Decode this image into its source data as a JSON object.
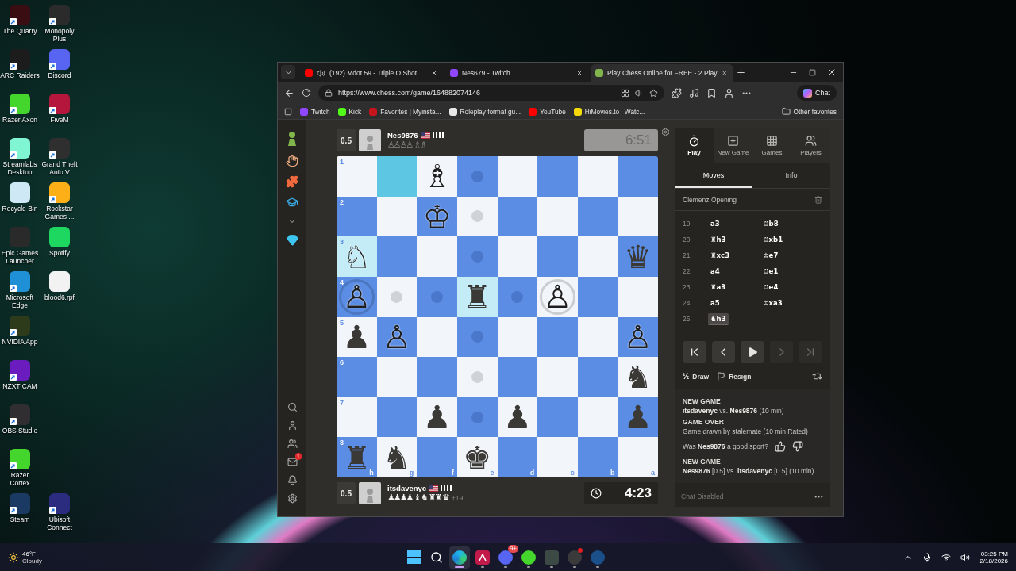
{
  "desktop": {
    "rows": [
      {
        "items": [
          {
            "label": "The Quarry",
            "color": "#3a0d12",
            "shortcut": true
          },
          {
            "label": "Monopoly Plus",
            "color": "#2b2b2b",
            "shortcut": true
          }
        ]
      },
      {
        "items": [
          {
            "label": "ARC Raiders",
            "color": "#1c1c1c",
            "shortcut": true
          },
          {
            "label": "Discord",
            "color": "#5865f2",
            "shortcut": true
          }
        ]
      },
      {
        "items": [
          {
            "label": "Razer Axon",
            "color": "#44d62c",
            "shortcut": true
          },
          {
            "label": "FiveM",
            "color": "#b5173c",
            "shortcut": true
          }
        ]
      },
      {
        "items": [
          {
            "label": "Streamlabs Desktop",
            "color": "#80f5d2",
            "shortcut": true
          },
          {
            "label": "Grand Theft Auto V",
            "color": "#2f2f2f",
            "shortcut": true
          }
        ]
      },
      {
        "items": [
          {
            "label": "Recycle Bin",
            "color": "#cfe8f5",
            "shortcut": false
          },
          {
            "label": "Rockstar Games ...",
            "color": "#fcaf17",
            "shortcut": true
          }
        ]
      },
      {
        "items": [
          {
            "label": "Epic Games Launcher",
            "color": "#2a2a2a",
            "shortcut": false
          },
          {
            "label": "Spotify",
            "color": "#1ed760",
            "shortcut": false
          }
        ]
      },
      {
        "items": [
          {
            "label": "Microsoft Edge",
            "color": "#1f8fd6",
            "shortcut": true
          },
          {
            "label": "blood6.rpf",
            "color": "#f2f2f2",
            "shortcut": false
          }
        ]
      },
      {
        "items": [
          {
            "label": "NVIDIA App",
            "color": "#2e3b1a",
            "shortcut": true
          }
        ]
      },
      {
        "items": [
          {
            "label": "NZXT CAM",
            "color": "#6a1cbf",
            "shortcut": true
          }
        ]
      },
      {
        "items": [
          {
            "label": "OBS Studio",
            "color": "#302e31",
            "shortcut": true
          }
        ]
      },
      {
        "items": [
          {
            "label": "Razer Cortex",
            "color": "#44d62c",
            "shortcut": true
          }
        ]
      },
      {
        "items": [
          {
            "label": "Steam",
            "color": "#1b3a63",
            "shortcut": true
          },
          {
            "label": "Ubisoft Connect",
            "color": "#2b2b80",
            "shortcut": true
          }
        ]
      }
    ]
  },
  "browser": {
    "tabs": [
      {
        "title": "(192) Mdot 59 - Triple O Shot",
        "color": "#ff0000",
        "audio": true,
        "selected": false
      },
      {
        "title": "Nes679 - Twitch",
        "color": "#9146ff",
        "audio": false,
        "selected": false
      },
      {
        "title": "Play Chess Online for FREE - 2 Play",
        "color": "#81b64c",
        "audio": false,
        "selected": true
      }
    ],
    "address": "https://www.chess.com/game/164882074146",
    "chat_button": "Chat",
    "bookmarks": [
      {
        "label": "Twitch",
        "color": "#9146ff"
      },
      {
        "label": "Kick",
        "color": "#53fc18"
      },
      {
        "label": "Favorites | Myinsta...",
        "color": "#c4161c"
      },
      {
        "label": "Roleplay format gu...",
        "color": "#e8e8e8"
      },
      {
        "label": "YouTube",
        "color": "#ff0000"
      },
      {
        "label": "HiMovies.to | Watc...",
        "color": "#f5d90a"
      }
    ],
    "other_favorites": "Other favorites"
  },
  "chess": {
    "messages_badge": "1",
    "top_player": {
      "score": "0.5",
      "name": "Nes9876",
      "captured": "♙♙♙♙ ♗♗",
      "clock": "6:51",
      "active": false
    },
    "board": {
      "files": [
        "h",
        "g",
        "f",
        "e",
        "d",
        "c",
        "b",
        "a"
      ],
      "ranks": [
        {
          "label": "1",
          "squares": [
            {
              "dot": false,
              "ring": false,
              "highlighted": false
            },
            {
              "dot": false,
              "ring": false,
              "highlighted": true
            },
            {
              "piece": "♗",
              "white": true,
              "dot": false,
              "ring": false,
              "highlighted": false
            },
            {
              "dot": true,
              "ring": false,
              "highlighted": false
            },
            {
              "dot": false,
              "ring": false,
              "highlighted": false
            },
            {
              "dot": false,
              "ring": false,
              "highlighted": false
            },
            {
              "dot": false,
              "ring": false,
              "highlighted": false
            },
            {
              "dot": false,
              "ring": false,
              "highlighted": false
            }
          ]
        },
        {
          "label": "2",
          "squares": [
            {
              "dot": false,
              "ring": false,
              "highlighted": false
            },
            {
              "dot": false,
              "ring": false,
              "highlighted": false
            },
            {
              "piece": "♔",
              "white": true,
              "dot": false,
              "ring": false,
              "highlighted": false
            },
            {
              "dot": true,
              "ring": false,
              "highlighted": false
            },
            {
              "dot": false,
              "ring": false,
              "highlighted": false
            },
            {
              "dot": false,
              "ring": false,
              "highlighted": false
            },
            {
              "dot": false,
              "ring": false,
              "highlighted": false
            },
            {
              "dot": false,
              "ring": false,
              "highlighted": false
            }
          ]
        },
        {
          "label": "3",
          "squares": [
            {
              "piece": "♘",
              "white": true,
              "dot": false,
              "ring": false,
              "highlighted": true
            },
            {
              "dot": false,
              "ring": false,
              "highlighted": false
            },
            {
              "dot": false,
              "ring": false,
              "highlighted": false
            },
            {
              "dot": true,
              "ring": false,
              "highlighted": false
            },
            {
              "dot": false,
              "ring": false,
              "highlighted": false
            },
            {
              "dot": false,
              "ring": false,
              "highlighted": false
            },
            {
              "dot": false,
              "ring": false,
              "highlighted": false
            },
            {
              "piece": "♛",
              "white": false,
              "dot": false,
              "ring": false,
              "highlighted": false
            }
          ]
        },
        {
          "label": "4",
          "squares": [
            {
              "piece": "♙",
              "white": true,
              "dot": false,
              "ring": true,
              "highlighted": false
            },
            {
              "dot": true,
              "ring": false,
              "highlighted": false
            },
            {
              "dot": true,
              "ring": false,
              "highlighted": false
            },
            {
              "piece": "♜",
              "white": false,
              "dot": false,
              "ring": false,
              "highlighted": true
            },
            {
              "dot": true,
              "ring": false,
              "highlighted": false
            },
            {
              "piece": "♙",
              "white": true,
              "dot": false,
              "ring": true,
              "highlighted": false
            },
            {
              "dot": false,
              "ring": false,
              "highlighted": false
            },
            {
              "dot": false,
              "ring": false,
              "highlighted": false
            }
          ]
        },
        {
          "label": "5",
          "squares": [
            {
              "piece": "♟",
              "white": false,
              "dot": false,
              "ring": false,
              "highlighted": false
            },
            {
              "piece": "♙",
              "white": true,
              "dot": false,
              "ring": false,
              "highlighted": false
            },
            {
              "dot": false,
              "ring": false,
              "highlighted": false
            },
            {
              "dot": true,
              "ring": false,
              "highlighted": false
            },
            {
              "dot": false,
              "ring": false,
              "highlighted": false
            },
            {
              "dot": false,
              "ring": false,
              "highlighted": false
            },
            {
              "dot": false,
              "ring": false,
              "highlighted": false
            },
            {
              "piece": "♙",
              "white": true,
              "dot": false,
              "ring": false,
              "highlighted": false
            }
          ]
        },
        {
          "label": "6",
          "squares": [
            {
              "dot": false,
              "ring": false,
              "highlighted": false
            },
            {
              "dot": false,
              "ring": false,
              "highlighted": false
            },
            {
              "dot": false,
              "ring": false,
              "highlighted": false
            },
            {
              "dot": true,
              "ring": false,
              "highlighted": false
            },
            {
              "dot": false,
              "ring": false,
              "highlighted": false
            },
            {
              "dot": false,
              "ring": false,
              "highlighted": false
            },
            {
              "dot": false,
              "ring": false,
              "highlighted": false
            },
            {
              "piece": "♞",
              "white": false,
              "dot": false,
              "ring": false,
              "highlighted": false
            }
          ]
        },
        {
          "label": "7",
          "squares": [
            {
              "dot": false,
              "ring": false,
              "highlighted": false
            },
            {
              "dot": false,
              "ring": false,
              "highlighted": false
            },
            {
              "piece": "♟",
              "white": false,
              "dot": false,
              "ring": false,
              "highlighted": false
            },
            {
              "dot": true,
              "ring": false,
              "highlighted": false
            },
            {
              "piece": "♟",
              "white": false,
              "dot": false,
              "ring": false,
              "highlighted": false
            },
            {
              "dot": false,
              "ring": false,
              "highlighted": false
            },
            {
              "dot": false,
              "ring": false,
              "highlighted": false
            },
            {
              "piece": "♟",
              "white": false,
              "dot": false,
              "ring": false,
              "highlighted": false
            }
          ]
        },
        {
          "label": "8",
          "squares": [
            {
              "piece": "♜",
              "white": false,
              "dot": false,
              "ring": false,
              "highlighted": false
            },
            {
              "piece": "♞",
              "white": false,
              "dot": false,
              "ring": false,
              "highlighted": false
            },
            {
              "dot": false,
              "ring": false,
              "highlighted": false
            },
            {
              "piece": "♚",
              "white": false,
              "dot": false,
              "ring": false,
              "highlighted": false
            },
            {
              "dot": false,
              "ring": false,
              "highlighted": false
            },
            {
              "dot": false,
              "ring": false,
              "highlighted": false
            },
            {
              "dot": false,
              "ring": false,
              "highlighted": false
            },
            {
              "dot": false,
              "ring": false,
              "highlighted": false
            }
          ]
        }
      ]
    },
    "bottom_player": {
      "score": "0.5",
      "name": "itsdavenyc",
      "captured": "♟♟♟♟ ♝ ♞ ♜♜ ♛",
      "advantage": "+19",
      "clock": "4:23",
      "active": true
    },
    "panel": {
      "tabs": [
        {
          "kind": "play",
          "label": "Play",
          "selected": true
        },
        {
          "kind": "new",
          "label": "New Game",
          "selected": false
        },
        {
          "kind": "games",
          "label": "Games",
          "selected": false
        },
        {
          "kind": "players",
          "label": "Players",
          "selected": false
        }
      ],
      "subtabs": [
        {
          "label": "Moves",
          "selected": true
        },
        {
          "label": "Info",
          "selected": false
        }
      ],
      "opening": "Clemenz Opening",
      "moves": [
        {
          "number": "19.",
          "white": {
            "san": "a3",
            "selected": false
          },
          "black": {
            "san": "♖b8",
            "selected": false
          }
        },
        {
          "number": "20.",
          "white": {
            "san": "♜h3",
            "selected": false
          },
          "black": {
            "san": "♖xb1",
            "selected": false
          }
        },
        {
          "number": "21.",
          "white": {
            "san": "♜xc3",
            "selected": false
          },
          "black": {
            "san": "♔e7",
            "selected": false
          }
        },
        {
          "number": "22.",
          "white": {
            "san": "a4",
            "selected": false
          },
          "black": {
            "san": "♖e1",
            "selected": false
          }
        },
        {
          "number": "23.",
          "white": {
            "san": "♜a3",
            "selected": false
          },
          "black": {
            "san": "♖e4",
            "selected": false
          }
        },
        {
          "number": "24.",
          "white": {
            "san": "a5",
            "selected": false
          },
          "black": {
            "san": "♔xa3",
            "selected": false
          }
        },
        {
          "number": "25.",
          "white": {
            "san": "♞h3",
            "selected": true
          }
        }
      ],
      "nav_buttons": [
        {
          "kind": "first",
          "disabled": false
        },
        {
          "kind": "prev",
          "disabled": false
        },
        {
          "kind": "play",
          "disabled": false
        },
        {
          "kind": "next",
          "disabled": true
        },
        {
          "kind": "last",
          "disabled": true
        }
      ],
      "actions": [
        {
          "kind": "draw",
          "icon": "½",
          "label": "Draw"
        },
        {
          "kind": "resign",
          "label": "Resign"
        }
      ],
      "chat": [
        {
          "kind": "heading",
          "text": "NEW GAME"
        },
        {
          "kind": "line",
          "text": "**itsdavenyc** vs. **Nes9876** (10 min)"
        },
        {
          "kind": "heading",
          "text": "GAME OVER"
        },
        {
          "kind": "line",
          "text": "Game drawn by stalemate (10 min Rated)"
        },
        {
          "kind": "sport",
          "text": "Was **Nes9876** a good sport?"
        },
        {
          "kind": "heading",
          "text": "NEW GAME"
        },
        {
          "kind": "line",
          "text": "**Nes9876** [0.5] vs. **itsdavenyc** [0.5] (10 min)"
        }
      ],
      "chat_placeholder": "Chat Disabled"
    }
  },
  "taskbar": {
    "weather": {
      "temp": "46°F",
      "condition": "Cloudy"
    },
    "apps": [
      {
        "kind": "start"
      },
      {
        "kind": "search"
      },
      {
        "kind": "edge",
        "active": true
      },
      {
        "kind": "ascend",
        "active": false
      },
      {
        "kind": "discord",
        "active": false,
        "badge": "9+"
      },
      {
        "kind": "razer",
        "active": false
      },
      {
        "kind": "xbox",
        "active": false
      },
      {
        "kind": "obs",
        "active": false,
        "alert": true
      },
      {
        "kind": "steam",
        "active": false
      }
    ],
    "clock": {
      "time": "03:25 PM",
      "date": "2/18/2026"
    }
  }
}
